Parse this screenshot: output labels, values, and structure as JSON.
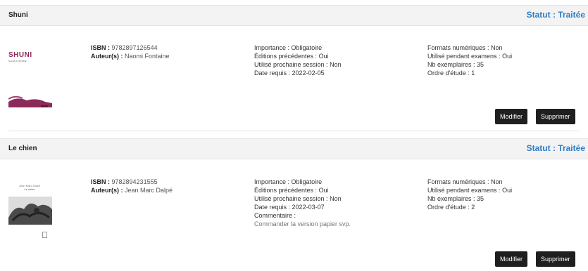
{
  "labels": {
    "status_prefix": "Statut :",
    "isbn": "ISBN :",
    "authors": "Auteur(s) :",
    "importance": "Importance :",
    "previous_editions": "Éditions précédentes :",
    "next_session": "Utilisé prochaine session :",
    "required_date": "Date requis :",
    "comment": "Commentaire :",
    "digital_formats": "Formats numériques :",
    "used_exams": "Utilisé pendant examens :",
    "copies": "Nb exemplaires :",
    "study_order": "Ordre d'étude :",
    "edit_button": "Modifier",
    "delete_button": "Supprimer"
  },
  "books": [
    {
      "title": "Shuni",
      "status": "Traitée",
      "cover_text": "SHUNI",
      "cover_subtext": "NAOMI FONTAINE",
      "cover_color": "#8c2a5a",
      "isbn": "9782897126544",
      "authors": "Naomi Fontaine",
      "importance": "Obligatoire",
      "previous_editions": "Oui",
      "next_session": "Non",
      "required_date": "2022-02-05",
      "digital_formats": "Non",
      "used_exams": "Oui",
      "copies": "35",
      "study_order": "1"
    },
    {
      "title": "Le chien",
      "status": "Traitée",
      "cover_text": "Jean Marc Dalpé",
      "cover_subtext": "Le chien",
      "isbn": "9782894231555",
      "authors": "Jean Marc Dalpé",
      "importance": "Obligatoire",
      "previous_editions": "Oui",
      "next_session": "Non",
      "required_date": "2022-03-07",
      "comment": "Commander la version papier svp.",
      "digital_formats": "Non",
      "used_exams": "Oui",
      "copies": "35",
      "study_order": "2"
    }
  ],
  "colors": {
    "status": "#2f7dc4",
    "button_bg": "#1f1f1f",
    "header_bg": "#f3f3f3"
  }
}
